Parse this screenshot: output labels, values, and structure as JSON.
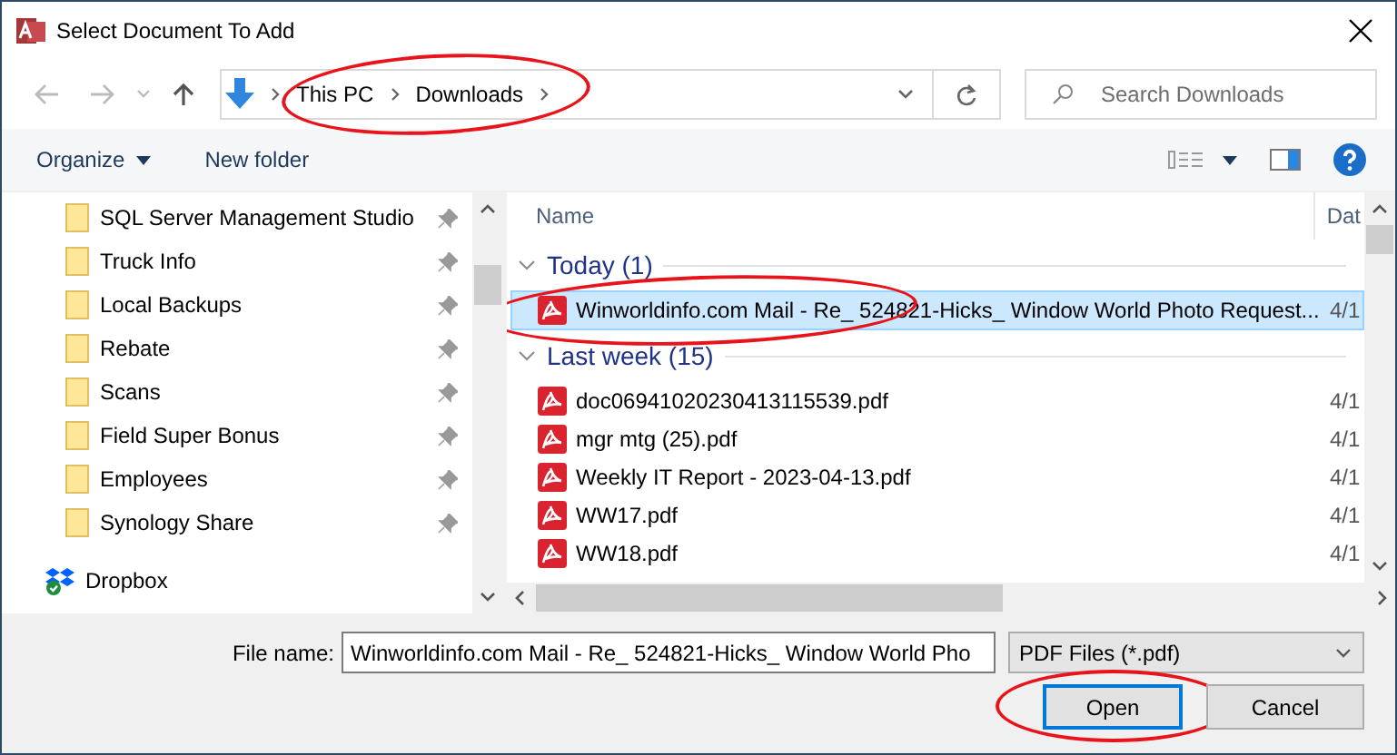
{
  "window": {
    "title": "Select Document To Add"
  },
  "address": {
    "segments": [
      "This PC",
      "Downloads"
    ],
    "circled": true
  },
  "search": {
    "placeholder": "Search Downloads"
  },
  "toolbar": {
    "organize": "Organize",
    "new_folder": "New folder"
  },
  "sidebar": {
    "items": [
      {
        "label": "SQL Server Management Studio",
        "kind": "folder",
        "pinned": true
      },
      {
        "label": "Truck Info",
        "kind": "folder",
        "pinned": true
      },
      {
        "label": "Local Backups",
        "kind": "folder",
        "pinned": true
      },
      {
        "label": "Rebate",
        "kind": "folder",
        "pinned": true
      },
      {
        "label": "Scans",
        "kind": "folder",
        "pinned": true
      },
      {
        "label": "Field Super Bonus",
        "kind": "folder",
        "pinned": true
      },
      {
        "label": "Employees",
        "kind": "folder",
        "pinned": true
      },
      {
        "label": "Synology Share",
        "kind": "folder",
        "pinned": true
      },
      {
        "label": "Dropbox",
        "kind": "dropbox",
        "pinned": false
      }
    ]
  },
  "file_list": {
    "columns": [
      "Name",
      "Dat"
    ],
    "groups": [
      {
        "label": "Today (1)",
        "expanded": true,
        "files": [
          {
            "name": "Winworldinfo.com Mail - Re_ 524821-Hicks_ Window World Photo Request...",
            "date": "4/1",
            "selected": true,
            "circled": true
          }
        ]
      },
      {
        "label": "Last week (15)",
        "expanded": true,
        "files": [
          {
            "name": "doc06941020230413115539.pdf",
            "date": "4/1",
            "selected": false,
            "circled": false
          },
          {
            "name": "mgr mtg (25).pdf",
            "date": "4/1",
            "selected": false,
            "circled": false
          },
          {
            "name": "Weekly IT Report - 2023-04-13.pdf",
            "date": "4/1",
            "selected": false,
            "circled": false
          },
          {
            "name": "WW17.pdf",
            "date": "4/1",
            "selected": false,
            "circled": false
          },
          {
            "name": "WW18.pdf",
            "date": "4/1",
            "selected": false,
            "circled": false
          }
        ]
      }
    ]
  },
  "file_name": {
    "label": "File name:",
    "value": "Winworldinfo.com Mail - Re_ 524821-Hicks_ Window World Pho"
  },
  "file_type": {
    "value": "PDF Files (*.pdf)"
  },
  "buttons": [
    {
      "label": "Open",
      "default": true,
      "circled": true
    },
    {
      "label": "Cancel",
      "default": false,
      "circled": false
    }
  ]
}
